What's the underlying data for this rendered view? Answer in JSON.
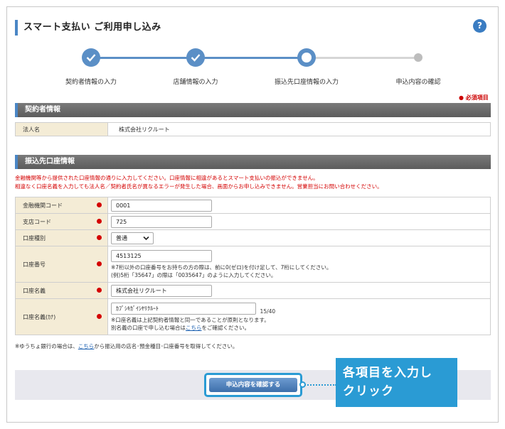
{
  "header": {
    "title": "スマート支払い ご利用申し込み",
    "help_icon": "?"
  },
  "steps": [
    {
      "label": "契約者情報の入力",
      "state": "done"
    },
    {
      "label": "店舗情報の入力",
      "state": "done"
    },
    {
      "label": "振込先口座情報の入力",
      "state": "current"
    },
    {
      "label": "申込内容の確認",
      "state": "pending"
    }
  ],
  "required_note": "● 必須項目",
  "contract_section": {
    "title": "契約者情報",
    "corp_label": "法人名",
    "corp_value": "株式会社リクルート"
  },
  "bank_section": {
    "title": "振込先口座情報",
    "warning_line1": "金融機関等から提供された口座情報の通りに入力してください。口座情報に相違があるとスマート支払いの振込ができません。",
    "warning_line2": "相違なく口座名義を入力しても法人名／契約者氏名が異なるエラーが発生した場合、画面からお申し込みできません。営業担当にお問い合わせください。",
    "fields": {
      "bank_code": {
        "label": "金融機関コード",
        "value": "0001"
      },
      "branch_code": {
        "label": "支店コード",
        "value": "725"
      },
      "account_type": {
        "label": "口座種別",
        "value": "普通"
      },
      "account_number": {
        "label": "口座番号",
        "value": "4513125",
        "note1": "※7桁以外の口座番号をお持ちの方の際は、前に0(ゼロ)を付け足して、7桁にしてください。",
        "note2": "(例)5桁「35647」の際は「0035647」のように入力してください。"
      },
      "account_name": {
        "label": "口座名義",
        "value": "株式会社リクルート"
      },
      "account_name_kana": {
        "label": "口座名義(ｶﾅ)",
        "value": "ｶﾌﾞｼｷｶﾞｲｼﾔﾘｸﾙｰﾄ",
        "counter": "15/40",
        "note1": "※口座名義は上記契約者情報と同一であることが原則となります。",
        "note2_prefix": "別名義の口座で申し込む場合は",
        "note2_link": "こちら",
        "note2_suffix": "をご確認ください。"
      }
    }
  },
  "bottom_note": {
    "prefix": "※ゆうちょ銀行の場合は、",
    "link": "こちら",
    "suffix": "から振込用の店名･預金種目･口座番号を取得してください。"
  },
  "confirm_button": "申込内容を確認する",
  "callout": {
    "line1": "各項目を入力し",
    "line2": "クリック"
  },
  "colors": {
    "accent": "#4a86c5",
    "required": "#d40000",
    "label_bg": "#f4ecd6",
    "callout": "#2a9bd4"
  }
}
